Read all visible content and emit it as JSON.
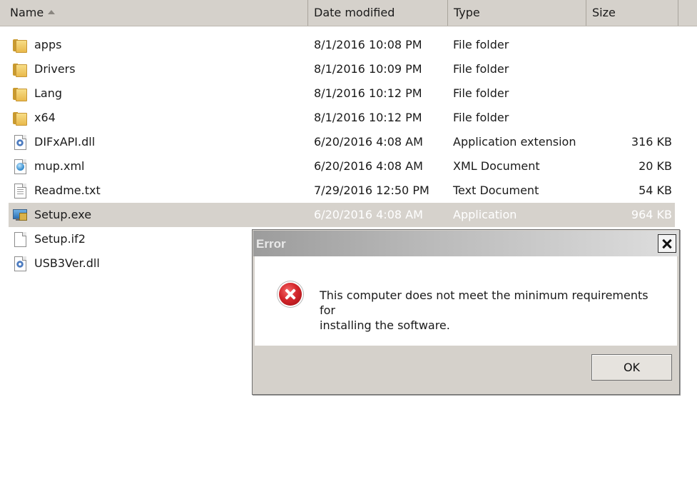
{
  "columns": {
    "name": "Name",
    "date": "Date modified",
    "type": "Type",
    "size": "Size"
  },
  "files": [
    {
      "name": "apps",
      "date": "8/1/2016 10:08 PM",
      "type": "File folder",
      "size": "",
      "icon": "folder-icon"
    },
    {
      "name": "Drivers",
      "date": "8/1/2016 10:09 PM",
      "type": "File folder",
      "size": "",
      "icon": "folder-icon"
    },
    {
      "name": "Lang",
      "date": "8/1/2016 10:12 PM",
      "type": "File folder",
      "size": "",
      "icon": "folder-icon"
    },
    {
      "name": "x64",
      "date": "8/1/2016 10:12 PM",
      "type": "File folder",
      "size": "",
      "icon": "folder-icon"
    },
    {
      "name": "DIFxAPI.dll",
      "date": "6/20/2016 4:08 AM",
      "type": "Application extension",
      "size": "316 KB",
      "icon": "dll-file-icon"
    },
    {
      "name": "mup.xml",
      "date": "6/20/2016 4:08 AM",
      "type": "XML Document",
      "size": "20 KB",
      "icon": "xml-file-icon"
    },
    {
      "name": "Readme.txt",
      "date": "7/29/2016 12:50 PM",
      "type": "Text Document",
      "size": "54 KB",
      "icon": "text-file-icon"
    },
    {
      "name": "Setup.exe",
      "date": "6/20/2016 4:08 AM",
      "type": "Application",
      "size": "964 KB",
      "icon": "exe-file-icon"
    },
    {
      "name": "Setup.if2",
      "date": "",
      "type": "",
      "size": "",
      "icon": "blank-file-icon"
    },
    {
      "name": "USB3Ver.dll",
      "date": "",
      "type": "",
      "size": "",
      "icon": "dll-file-icon"
    }
  ],
  "selected_index": 7,
  "dialog": {
    "title": "Error",
    "message_line1": "This computer does not meet the minimum requirements for",
    "message_line2": "installing the software.",
    "ok_label": "OK"
  },
  "colors": {
    "header_bg": "#d5d1cb",
    "selection_bg": "#d6d2cc",
    "error_red": "#d4262b"
  }
}
